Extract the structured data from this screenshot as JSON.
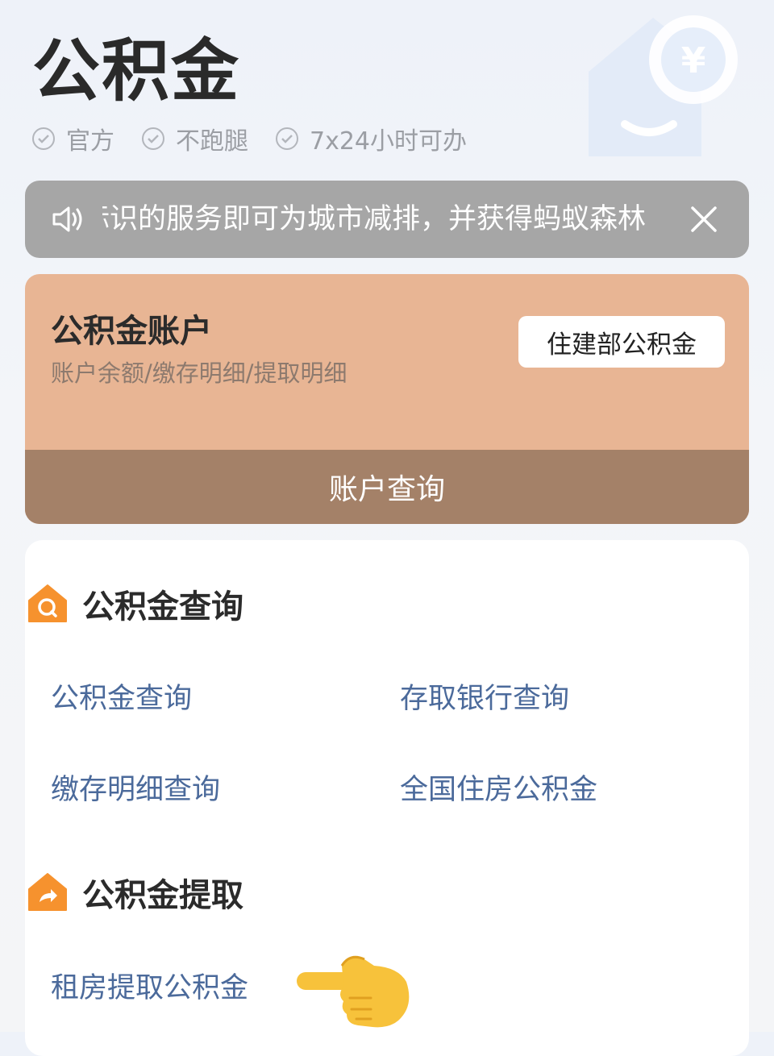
{
  "header": {
    "title": "公积金",
    "features": [
      {
        "icon": "check-circle-icon",
        "label": "官方"
      },
      {
        "icon": "check-circle-icon",
        "label": "不跑腿"
      },
      {
        "icon": "check-circle-icon",
        "label": "7x24小时可办"
      }
    ]
  },
  "notice": {
    "icon": "speaker-icon",
    "text": "标识的服务即可为城市减排，并获得蚂蚁森林",
    "close_icon": "close-icon"
  },
  "account": {
    "title": "公积金账户",
    "subtitle": "账户余额/缴存明细/提取明细",
    "ministry_button": "住建部公积金",
    "query_button": "账户查询"
  },
  "query_section": {
    "title": "公积金查询",
    "icon": "house-search-icon",
    "items": [
      "公积金查询",
      "存取银行查询",
      "缴存明细查询",
      "全国住房公积金"
    ]
  },
  "withdraw_section": {
    "title": "公积金提取",
    "icon": "house-share-icon",
    "items": [
      "租房提取公积金"
    ]
  },
  "colors": {
    "accent_orange": "#f6922e",
    "link_blue": "#4b6a9b",
    "account_card": "#e8b594",
    "account_footer": "#a48168",
    "notice_bg": "#a6a6a6"
  }
}
